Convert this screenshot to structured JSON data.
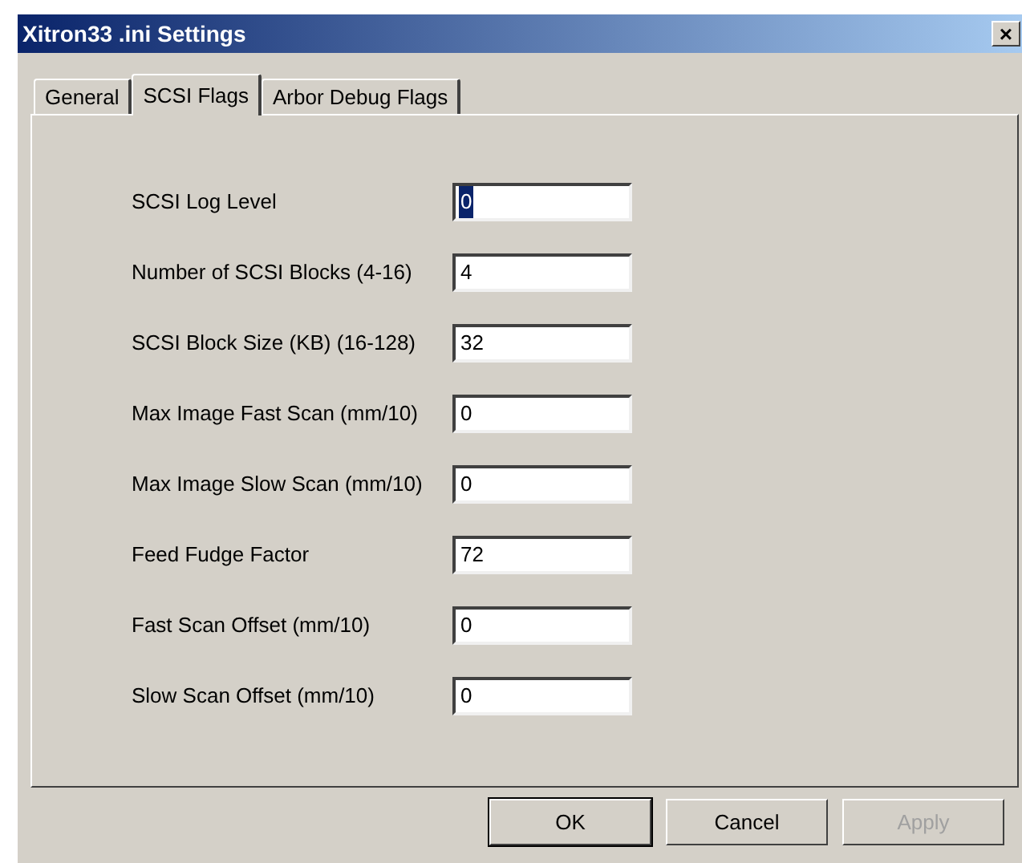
{
  "window": {
    "title": "Xitron33 .ini Settings",
    "close": "×"
  },
  "tabs": [
    {
      "label": "General",
      "selected": false
    },
    {
      "label": "SCSI Flags",
      "selected": true
    },
    {
      "label": "Arbor Debug Flags",
      "selected": false
    }
  ],
  "fields": [
    {
      "label": "SCSI Log Level",
      "value": "0",
      "focused": true
    },
    {
      "label": "Number of SCSI Blocks (4-16)",
      "value": "4",
      "focused": false
    },
    {
      "label": "SCSI Block Size (KB) (16-128)",
      "value": "32",
      "focused": false
    },
    {
      "label": "Max Image Fast Scan (mm/10)",
      "value": "0",
      "focused": false
    },
    {
      "label": "Max Image Slow Scan (mm/10)",
      "value": "0",
      "focused": false
    },
    {
      "label": "Feed Fudge Factor",
      "value": "72",
      "focused": false
    },
    {
      "label": "Fast Scan Offset (mm/10)",
      "value": "0",
      "focused": false
    },
    {
      "label": "Slow Scan Offset (mm/10)",
      "value": "0",
      "focused": false
    }
  ],
  "buttons": [
    {
      "label": "OK",
      "default": true,
      "disabled": false
    },
    {
      "label": "Cancel",
      "default": false,
      "disabled": false
    },
    {
      "label": "Apply",
      "default": false,
      "disabled": true
    }
  ]
}
